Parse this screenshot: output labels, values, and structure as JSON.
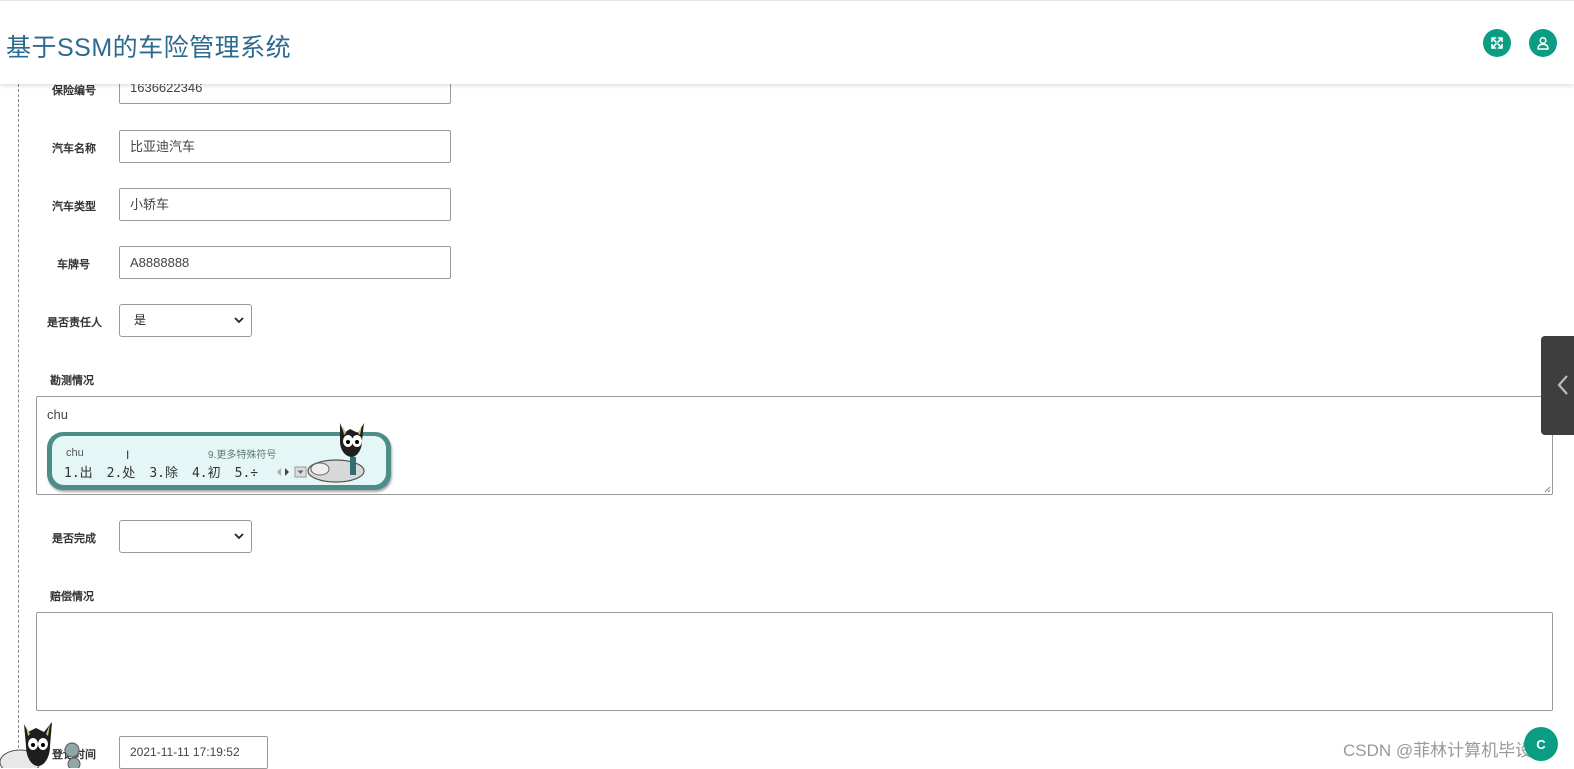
{
  "header": {
    "title": "基于SSM的车险管理系统",
    "fullscreen_icon": "fullscreen-icon",
    "user_icon": "user-icon",
    "accent_color": "#0a9d84",
    "title_color": "#2c6a8f"
  },
  "form": {
    "insurance_no": {
      "label": "保险编号",
      "value": "1636622346"
    },
    "car_name": {
      "label": "汽车名称",
      "value": "比亚迪汽车"
    },
    "car_type": {
      "label": "汽车类型",
      "value": "小轿车"
    },
    "plate_no": {
      "label": "车牌号",
      "value": "A8888888"
    },
    "is_responsible": {
      "label": "是否责任人",
      "selected": "是"
    },
    "survey": {
      "label": "勘测情况",
      "value": "chu"
    },
    "is_completed": {
      "label": "是否完成",
      "selected": ""
    },
    "compensation": {
      "label": "赔偿情况",
      "value": ""
    },
    "register_time": {
      "label": "登记时间",
      "value": "2021-11-11 17:19:52"
    }
  },
  "ime": {
    "pinyin": "chu",
    "more_symbols": "9.更多特殊符号",
    "candidates": [
      "1.出",
      "2.处",
      "3.除",
      "4.初",
      "5.÷"
    ]
  },
  "side_tab": {
    "icon": "chevron-left-icon"
  },
  "watermark": "CSDN @菲林计算机毕设",
  "fab": {
    "label": "C"
  }
}
